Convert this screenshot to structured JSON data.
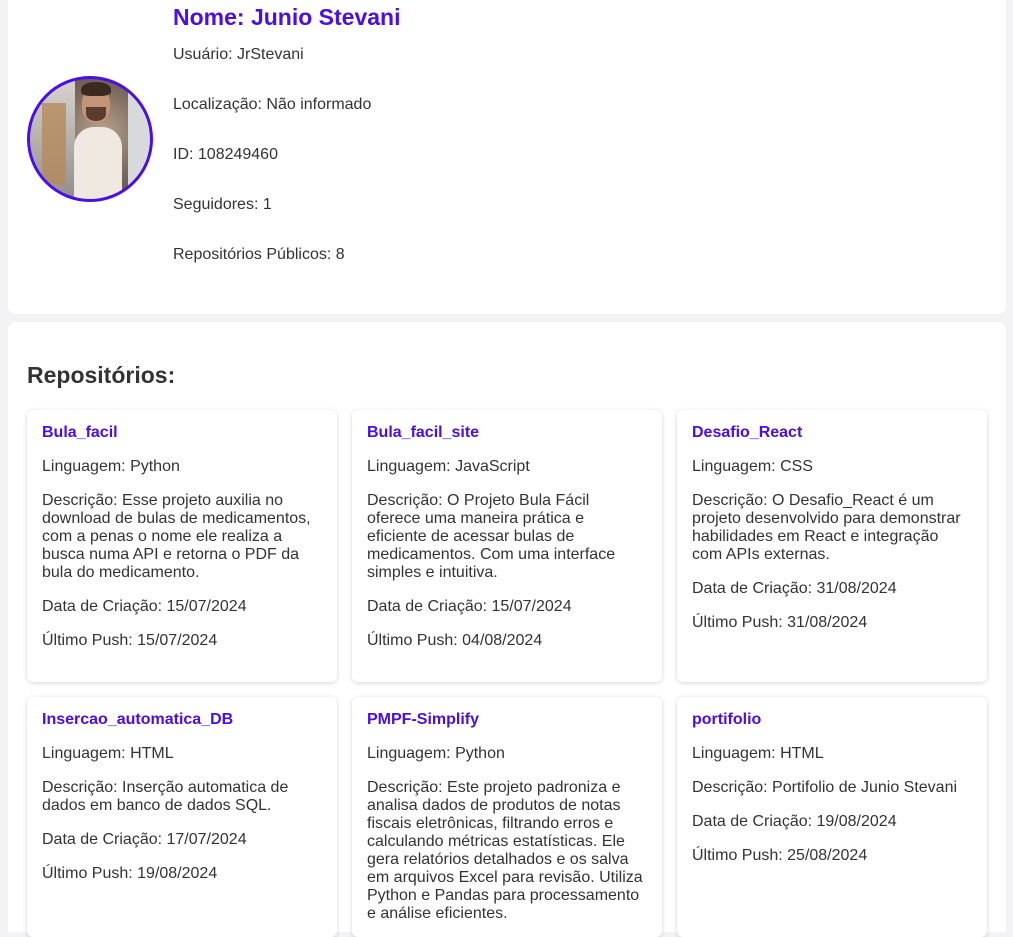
{
  "profile": {
    "name": "Nome: Junio Stevani",
    "user": "Usuário: JrStevani",
    "location": "Localização: Não informado",
    "id": "ID: 108249460",
    "followers": "Seguidores: 1",
    "public_repos": "Repositórios Públicos: 8"
  },
  "repos": {
    "heading": "Repositórios:",
    "items": [
      {
        "name": "Bula_facil",
        "language": "Linguagem: Python",
        "description": "Descrição: Esse projeto auxilia no download de bulas de medicamentos, com a penas o nome ele realiza a busca numa API e retorna o PDF da bula do medicamento.",
        "created": "Data de Criação: 15/07/2024",
        "pushed": "Último Push: 15/07/2024"
      },
      {
        "name": "Bula_facil_site",
        "language": "Linguagem: JavaScript",
        "description": "Descrição: O Projeto Bula Fácil oferece uma maneira prática e eficiente de acessar bulas de medicamentos. Com uma interface simples e intuitiva.",
        "created": "Data de Criação: 15/07/2024",
        "pushed": "Último Push: 04/08/2024"
      },
      {
        "name": "Desafio_React",
        "language": "Linguagem: CSS",
        "description": "Descrição: O Desafio_React é um projeto desenvolvido para demonstrar habilidades em React e integração com APIs externas.",
        "created": "Data de Criação: 31/08/2024",
        "pushed": "Último Push: 31/08/2024"
      },
      {
        "name": "Insercao_automatica_DB",
        "language": "Linguagem: HTML",
        "description": "Descrição: Inserção automatica de dados em banco de dados SQL.",
        "created": "Data de Criação: 17/07/2024",
        "pushed": "Último Push: 19/08/2024"
      },
      {
        "name": "PMPF-Simplify",
        "language": "Linguagem: Python",
        "description": "Descrição: Este projeto padroniza e analisa dados de produtos de notas fiscais eletrônicas, filtrando erros e calculando métricas estatísticas. Ele gera relatórios detalhados e os salva em arquivos Excel para revisão. Utiliza Python e Pandas para processamento e análise eficientes.",
        "created": "",
        "pushed": ""
      },
      {
        "name": "portifolio",
        "language": "Linguagem: HTML",
        "description": "Descrição: Portifolio de Junio Stevani",
        "created": "Data de Criação: 19/08/2024",
        "pushed": "Último Push: 25/08/2024"
      }
    ]
  },
  "colors": {
    "accent": "#4a0ee6",
    "text": "#333333",
    "page_bg": "#f3f3f5"
  }
}
